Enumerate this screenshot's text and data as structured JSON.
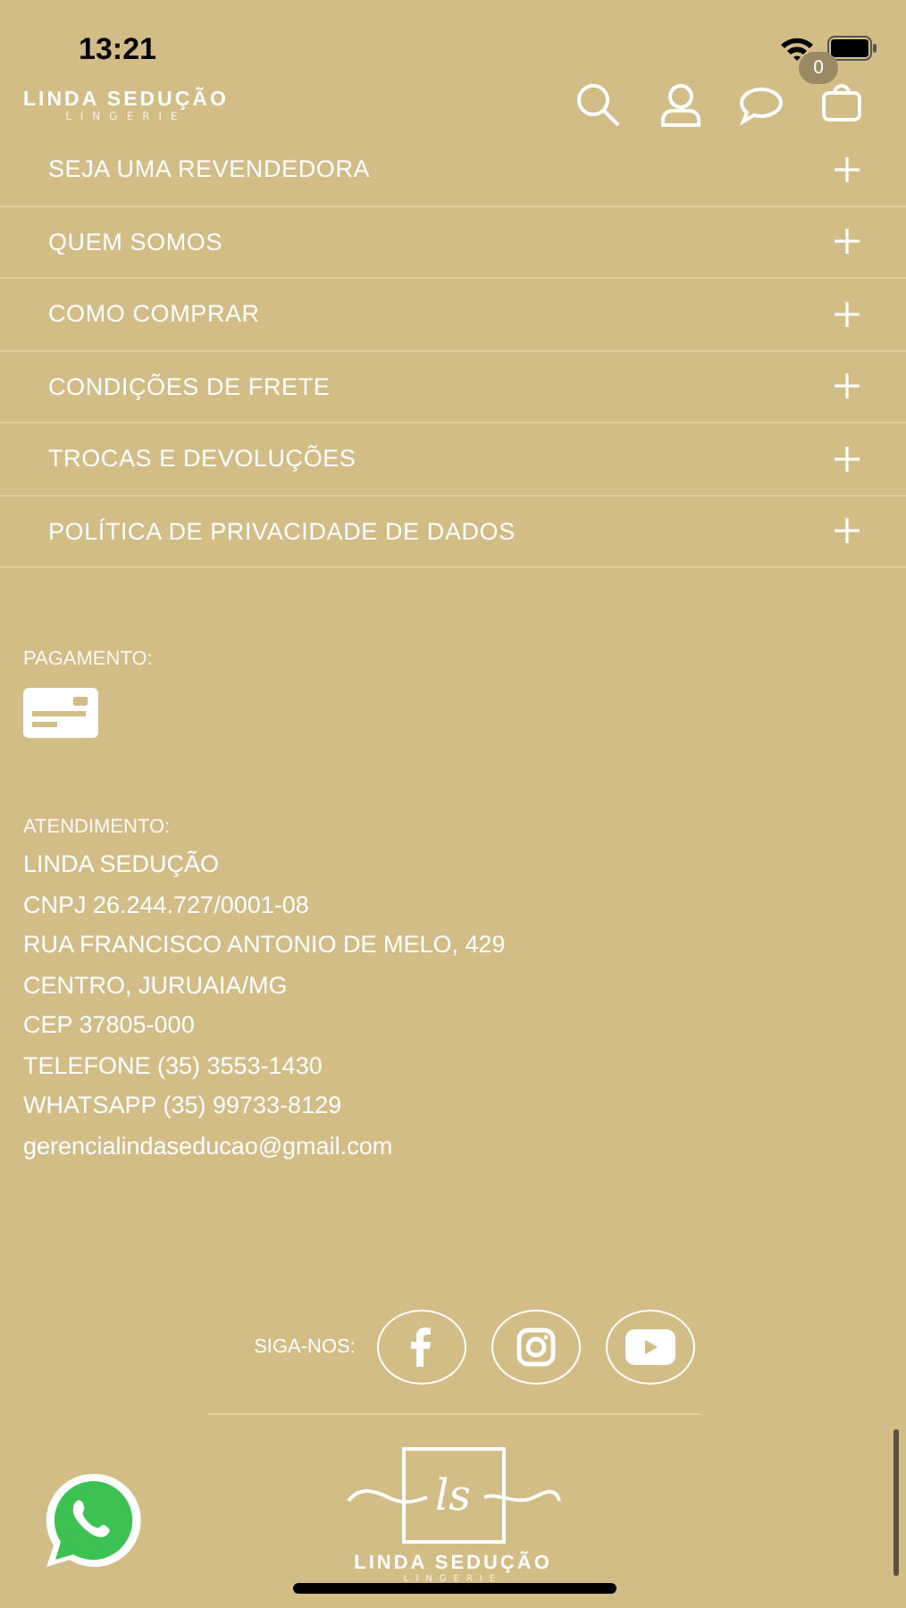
{
  "status_bar": {
    "time": "13:21"
  },
  "header": {
    "logo": {
      "name": "LINDA SEDUÇÃO",
      "tagline": "LINGERIE"
    },
    "cart_count": "0"
  },
  "accordion": [
    {
      "label": "SEJA UMA REVENDEDORA",
      "expanded": false
    },
    {
      "label": "QUEM SOMOS",
      "expanded": false
    },
    {
      "label": "COMO COMPRAR",
      "expanded": false
    },
    {
      "label": "CONDIÇÕES DE FRETE",
      "expanded": false
    },
    {
      "label": "TROCAS E DEVOLUÇÕES",
      "expanded": false
    },
    {
      "label": "POLÍTICA DE PRIVACIDADE DE DADOS",
      "expanded": false
    }
  ],
  "payment": {
    "heading": "PAGAMENTO:"
  },
  "contact": {
    "heading": "ATENDIMENTO:",
    "lines": [
      "LINDA SEDUÇÃO",
      "CNPJ 26.244.727/0001-08",
      "RUA FRANCISCO ANTONIO DE MELO, 429",
      "CENTRO, JURUAIA/MG",
      "CEP 37805-000",
      "TELEFONE (35) 3553-1430",
      "WHATSAPP (35) 99733-8129",
      "gerencialindaseducao@gmail.com"
    ]
  },
  "social": {
    "label": "SIGA-NOS:",
    "networks": [
      {
        "kind": "facebook"
      },
      {
        "kind": "instagram"
      },
      {
        "kind": "youtube"
      }
    ]
  },
  "footer_logo": {
    "monogram": "ls",
    "name": "LINDA SEDUÇÃO",
    "tagline": "LINGERIE"
  }
}
